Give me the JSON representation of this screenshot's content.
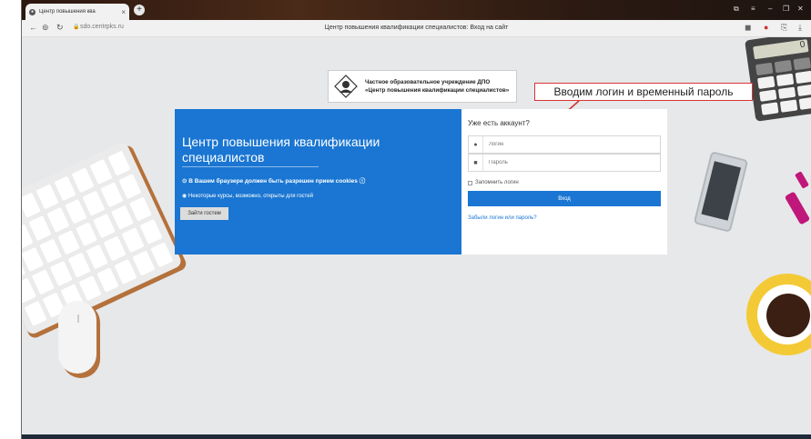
{
  "browser": {
    "tab_title": "Центр повышения ква",
    "tab_close": "×",
    "new_tab": "+",
    "url": "sdo.centrpks.ru",
    "page_title": "Центр повышения квалификации специалистов: Вход на сайт"
  },
  "header": {
    "logo_line1": "Частное образовательное учреждение ДПО",
    "logo_line2": "«Центр повышения квалификации специалистов»"
  },
  "annotation": {
    "callout_text": "Вводим логин и временный пароль",
    "color": "#d33333"
  },
  "left_panel": {
    "title": "Центр повышения квалификации специалистов",
    "cookies_note": "В Вашем браузере должен быть разрешен прием cookies",
    "guest_note": "Некоторые курсы, возможно, открыты для гостей",
    "guest_button": "Зайти гостем",
    "bg_color": "#1a76d2"
  },
  "login": {
    "heading": "Уже есть аккаунт?",
    "username_placeholder": "Логин",
    "password_placeholder": "Пароль",
    "remember_label": "Запомнить логин",
    "login_button": "Вход",
    "forgot_link": "Забыли логин или пароль?"
  },
  "decor": {
    "calculator_display": "0"
  }
}
